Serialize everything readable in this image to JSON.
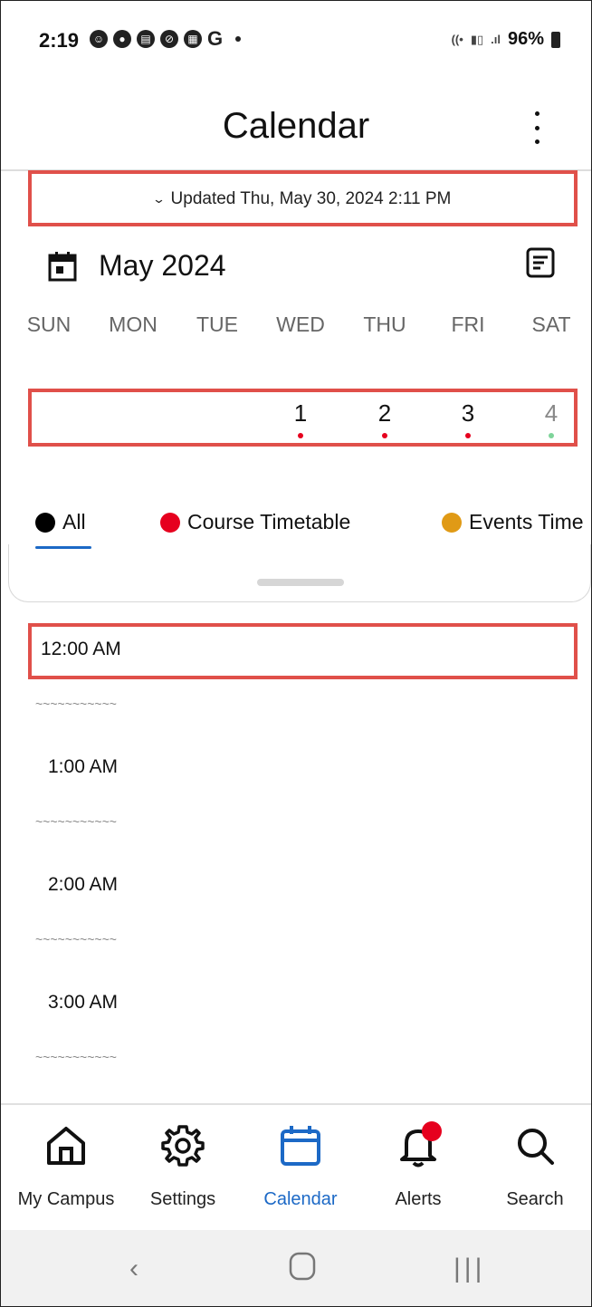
{
  "status_bar": {
    "time": "2:19",
    "notif_g": "G",
    "battery": "96%"
  },
  "header": {
    "title": "Calendar"
  },
  "updated_bar": {
    "label": "Updated Thu, May 30, 2024 2:11 PM"
  },
  "month": {
    "label": "May 2024"
  },
  "weekdays": [
    "SUN",
    "MON",
    "TUE",
    "WED",
    "THU",
    "FRI",
    "SAT"
  ],
  "days": [
    {
      "num": "1",
      "dot_color": "#e6001e"
    },
    {
      "num": "2",
      "dot_color": "#e6001e"
    },
    {
      "num": "3",
      "dot_color": "#e6001e"
    },
    {
      "num": "4",
      "dot_color": "#7ed49a"
    }
  ],
  "filters": [
    {
      "label": "All",
      "color": "#000000",
      "selected": true
    },
    {
      "label": "Course Timetable",
      "color": "#e6001e",
      "selected": false
    },
    {
      "label": "Events Time",
      "color": "#e09a16",
      "selected": false
    }
  ],
  "time_slots": [
    {
      "label": "12:00 AM"
    },
    {
      "label": "1:00 AM"
    },
    {
      "label": "2:00 AM"
    },
    {
      "label": "3:00 AM"
    }
  ],
  "wavy": "~~~~~~~~~~~",
  "bottom_nav": [
    {
      "label": "My Campus",
      "icon": "home-icon",
      "active": false
    },
    {
      "label": "Settings",
      "icon": "gear-icon",
      "active": false
    },
    {
      "label": "Calendar",
      "icon": "calendar-icon",
      "active": true
    },
    {
      "label": "Alerts",
      "icon": "bell-icon",
      "active": false
    },
    {
      "label": "Search",
      "icon": "search-icon",
      "active": false
    }
  ],
  "colors": {
    "accent": "#1c69c6",
    "highlight_box": "#e0504a",
    "alert_badge": "#e6001e"
  }
}
